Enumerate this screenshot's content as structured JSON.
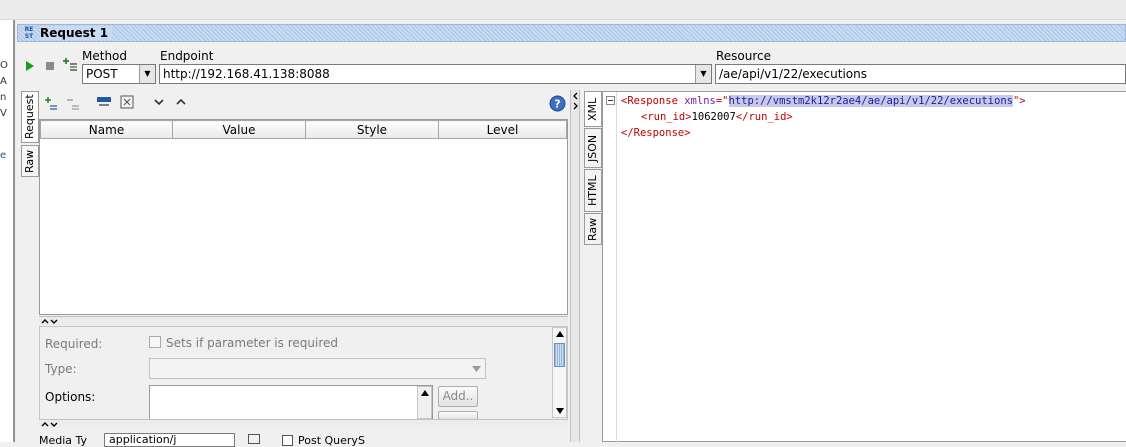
{
  "request": {
    "tab_title": "Request 1",
    "rest_icon_text": "RE ST",
    "method_label": "Method",
    "method_value": "POST",
    "endpoint_label": "Endpoint",
    "endpoint_value": "http://192.168.41.138:8088",
    "resource_label": "Resource",
    "resource_value": "/ae/api/v1/22/executions"
  },
  "left_tabs": [
    "Request",
    "Raw"
  ],
  "params_table": {
    "columns": [
      "Name",
      "Value",
      "Style",
      "Level"
    ]
  },
  "param_details": {
    "required_label": "Required:",
    "required_checkbox_label": "Sets if parameter is required",
    "type_label": "Type:",
    "options_label": "Options:",
    "add_button": "Add..",
    "media_type_label": "Media Ty",
    "media_type_value": "application/j",
    "post_query_label": "Post QueryS"
  },
  "response_tabs": [
    "XML",
    "JSON",
    "HTML",
    "Raw"
  ],
  "response_xml": {
    "open_tag": "<Response",
    "attr_name": "xmlns",
    "attr_eq": "=\"",
    "attr_value": "http://vmstm2k12r2ae4/ae/api/v1/22/executions",
    "attr_close": "\">",
    "child_open": "<run_id>",
    "child_value": "1062007",
    "child_close": "</run_id>",
    "close_tag": "</Response>"
  },
  "left_strip_chars": [
    "O",
    "A",
    "n",
    "V",
    "e"
  ]
}
